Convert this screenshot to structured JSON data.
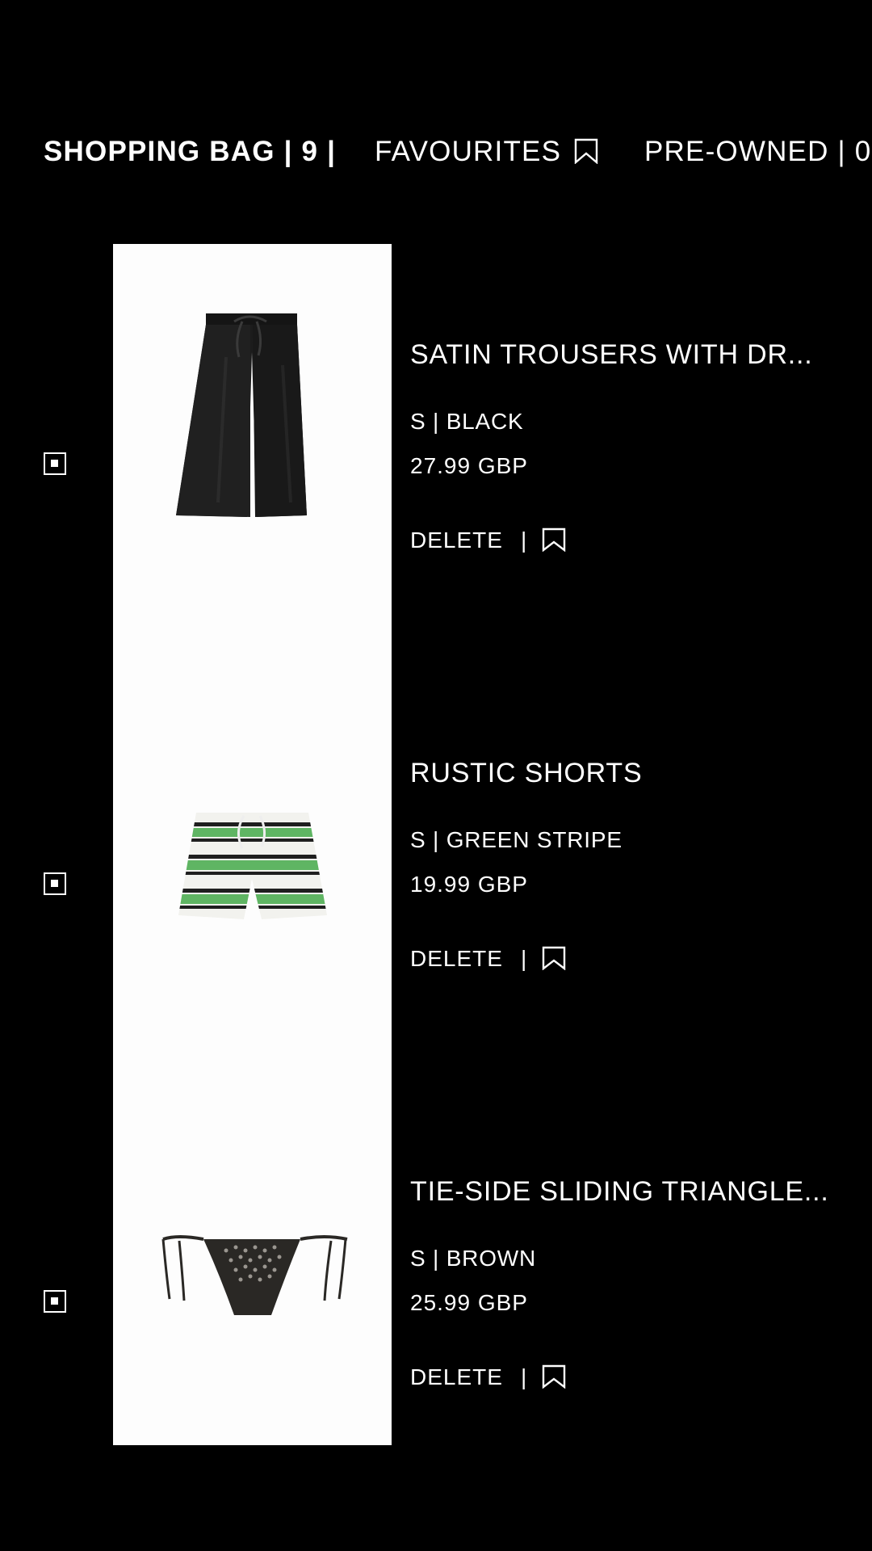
{
  "tabs": {
    "shopping_bag": "SHOPPING BAG | 9 |",
    "favourites": "FAVOURITES",
    "pre_owned": "PRE-OWNED | 0"
  },
  "items": [
    {
      "name": "SATIN TROUSERS WITH DR...",
      "variant": "S | BLACK",
      "price": "27.99 GBP",
      "delete": "DELETE",
      "separator": "|",
      "selected": true,
      "image_color": "#1c1c1c"
    },
    {
      "name": "RUSTIC SHORTS",
      "variant": "S | GREEN STRIPE",
      "price": "19.99 GBP",
      "delete": "DELETE",
      "separator": "|",
      "selected": true,
      "image_color": "#5fb563"
    },
    {
      "name": "TIE-SIDE SLIDING TRIANGLE...",
      "variant": "S | BROWN",
      "price": "25.99 GBP",
      "delete": "DELETE",
      "separator": "|",
      "selected": true,
      "image_color": "#2a2825"
    }
  ],
  "icons": {
    "favourite": "bookmark-icon",
    "checkbox": "checkbox-icon"
  },
  "colors": {
    "background": "#000000",
    "text": "#ffffff",
    "image_background": "#fdfdfd"
  }
}
